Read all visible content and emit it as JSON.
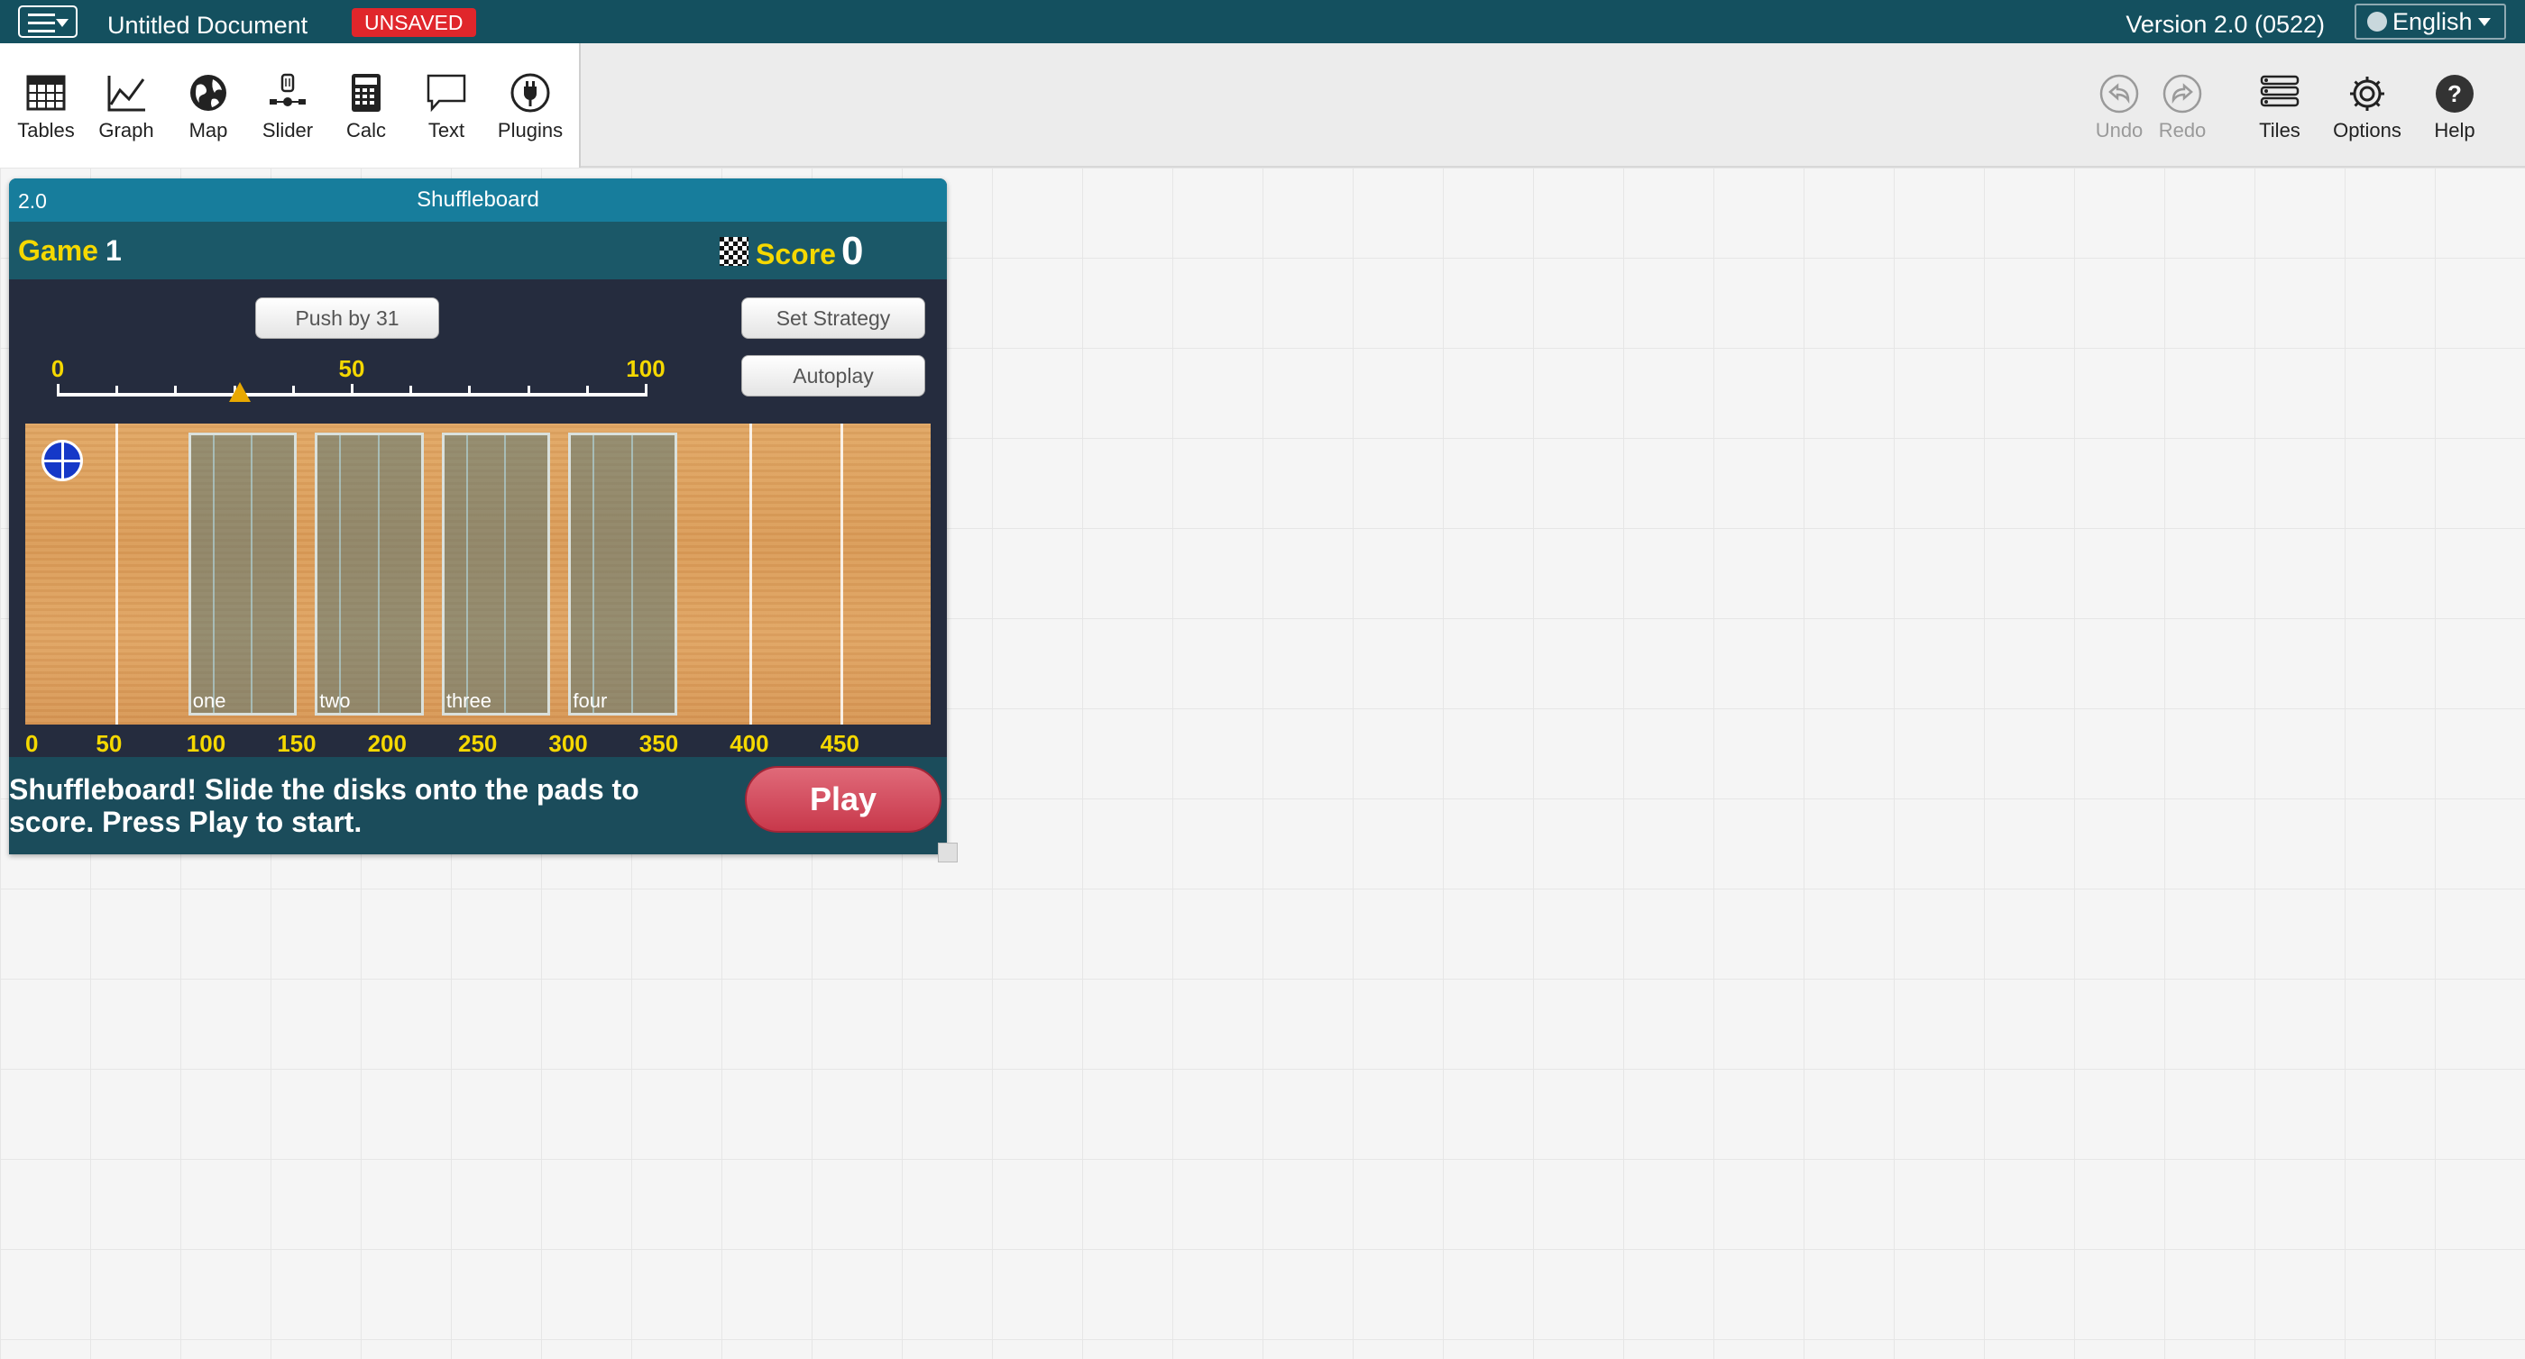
{
  "topbar": {
    "menu_icon": "hamburger-icon",
    "document_title": "Untitled Document",
    "unsaved_badge": "UNSAVED",
    "version": "Version 2.0 (0522)",
    "language": "English",
    "colors": {
      "bar": "#14505f",
      "badge": "#e0262b"
    }
  },
  "toolbar": {
    "tools": [
      {
        "label": "Tables",
        "icon": "table-icon"
      },
      {
        "label": "Graph",
        "icon": "graph-icon"
      },
      {
        "label": "Map",
        "icon": "globe-icon"
      },
      {
        "label": "Slider",
        "icon": "slider-icon"
      },
      {
        "label": "Calc",
        "icon": "calculator-icon"
      },
      {
        "label": "Text",
        "icon": "text-bubble-icon"
      },
      {
        "label": "Plugins",
        "icon": "plug-icon"
      }
    ],
    "right_tools": [
      {
        "label": "Undo",
        "icon": "undo-icon",
        "enabled": false
      },
      {
        "label": "Redo",
        "icon": "redo-icon",
        "enabled": false
      },
      {
        "label": "Tiles",
        "icon": "tiles-list-icon",
        "enabled": true
      },
      {
        "label": "Options",
        "icon": "gear-icon",
        "enabled": true
      },
      {
        "label": "Help",
        "icon": "help-icon",
        "enabled": true
      }
    ]
  },
  "tile": {
    "version": "2.0",
    "title": "Shuffleboard",
    "game_label": "Game",
    "game_number": "1",
    "score_label": "Score",
    "score_value": "0",
    "push_button": "Push by 31",
    "set_strategy_button": "Set Strategy",
    "autoplay_button": "Autoplay",
    "slider": {
      "labels": [
        "0",
        "50",
        "100"
      ],
      "value": 31,
      "min": 0,
      "max": 100
    },
    "pads": [
      "one",
      "two",
      "three",
      "four"
    ],
    "scale_labels": [
      "0",
      "50",
      "100",
      "150",
      "200",
      "250",
      "300",
      "350",
      "400",
      "450"
    ],
    "message": "Shuffleboard! Slide the disks onto the pads to score. Press Play to start.",
    "play_button": "Play",
    "colors": {
      "accent_yellow": "#f5d800",
      "play": "#c8384b",
      "title_bar": "#177d9c"
    }
  }
}
